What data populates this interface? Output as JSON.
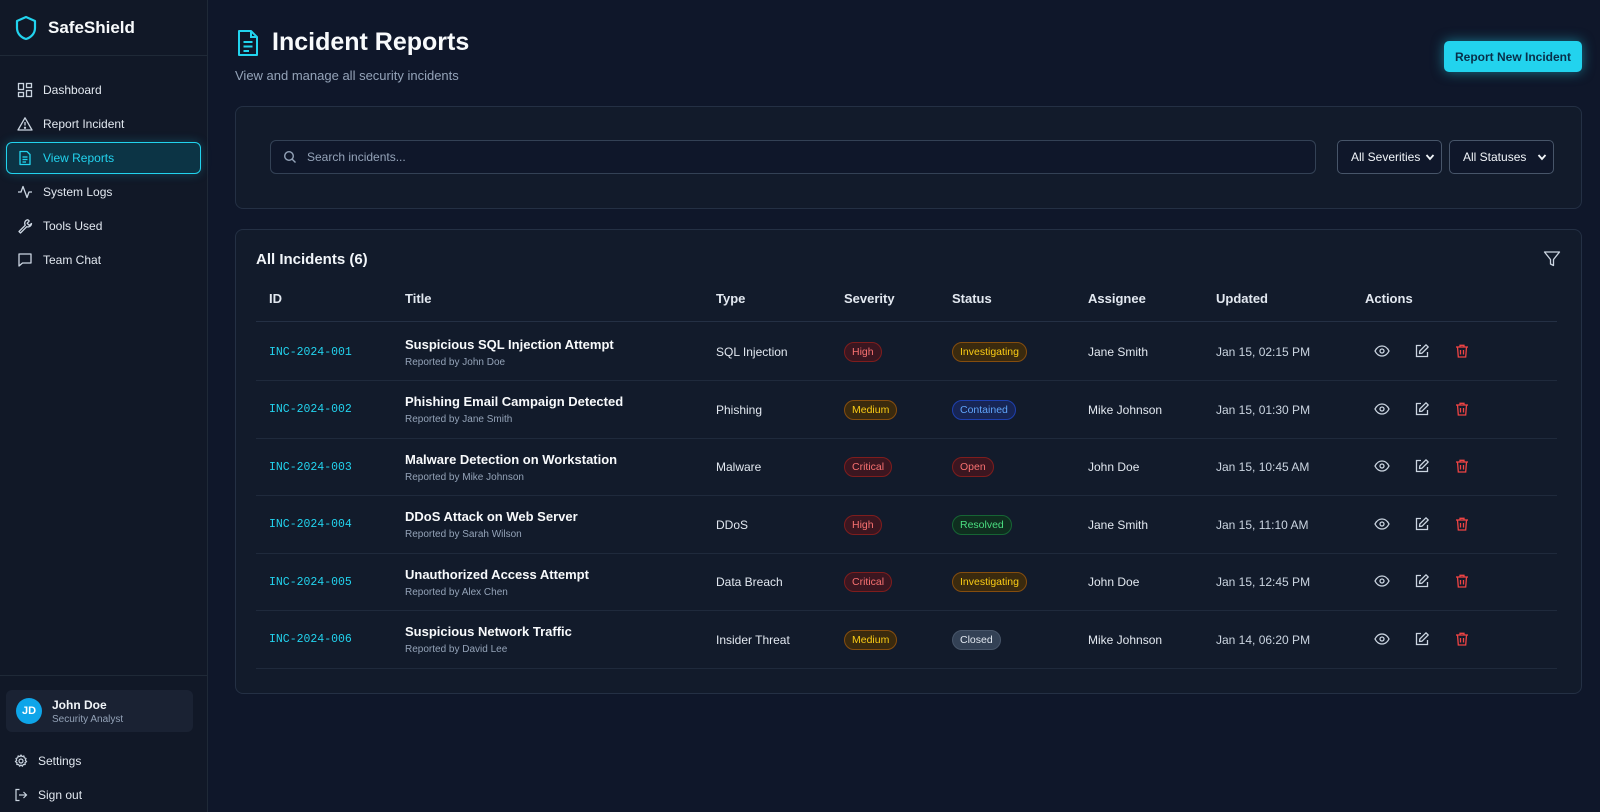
{
  "app": {
    "name": "SafeShield"
  },
  "nav": [
    {
      "label": "Dashboard",
      "icon": "dashboard-icon",
      "active": false
    },
    {
      "label": "Report Incident",
      "icon": "alert-triangle-icon",
      "active": false
    },
    {
      "label": "View Reports",
      "icon": "document-icon",
      "active": true
    },
    {
      "label": "System Logs",
      "icon": "activity-icon",
      "active": false
    },
    {
      "label": "Tools Used",
      "icon": "wrench-icon",
      "active": false
    },
    {
      "label": "Team Chat",
      "icon": "chat-icon",
      "active": false
    }
  ],
  "user": {
    "initials": "JD",
    "name": "John Doe",
    "role": "Security Analyst"
  },
  "bottom": {
    "settings": "Settings",
    "signout": "Sign out"
  },
  "page": {
    "title": "Incident Reports",
    "subtitle": "View and manage all security incidents",
    "report_button": "Report New Incident"
  },
  "filters": {
    "search_placeholder": "Search incidents...",
    "severity": "All Severities",
    "status": "All Statuses"
  },
  "table": {
    "title": "All Incidents (6)",
    "columns": [
      "ID",
      "Title",
      "Type",
      "Severity",
      "Status",
      "Assignee",
      "Updated",
      "Actions"
    ],
    "rows": [
      {
        "id": "INC-2024-001",
        "title": "Suspicious SQL Injection Attempt",
        "reporter": "Reported by John Doe",
        "type": "SQL Injection",
        "severity": "High",
        "status": "Investigating",
        "assignee": "Jane Smith",
        "updated": "Jan 15, 02:15 PM"
      },
      {
        "id": "INC-2024-002",
        "title": "Phishing Email Campaign Detected",
        "reporter": "Reported by Jane Smith",
        "type": "Phishing",
        "severity": "Medium",
        "status": "Contained",
        "assignee": "Mike Johnson",
        "updated": "Jan 15, 01:30 PM"
      },
      {
        "id": "INC-2024-003",
        "title": "Malware Detection on Workstation",
        "reporter": "Reported by Mike Johnson",
        "type": "Malware",
        "severity": "Critical",
        "status": "Open",
        "assignee": "John Doe",
        "updated": "Jan 15, 10:45 AM"
      },
      {
        "id": "INC-2024-004",
        "title": "DDoS Attack on Web Server",
        "reporter": "Reported by Sarah Wilson",
        "type": "DDoS",
        "severity": "High",
        "status": "Resolved",
        "assignee": "Jane Smith",
        "updated": "Jan 15, 11:10 AM"
      },
      {
        "id": "INC-2024-005",
        "title": "Unauthorized Access Attempt",
        "reporter": "Reported by Alex Chen",
        "type": "Data Breach",
        "severity": "Critical",
        "status": "Investigating",
        "assignee": "John Doe",
        "updated": "Jan 15, 12:45 PM"
      },
      {
        "id": "INC-2024-006",
        "title": "Suspicious Network Traffic",
        "reporter": "Reported by David Lee",
        "type": "Insider Threat",
        "severity": "Medium",
        "status": "Closed",
        "assignee": "Mike Johnson",
        "updated": "Jan 14, 06:20 PM"
      }
    ]
  },
  "colors": {
    "accent": "#22d3ee",
    "background": "#0f172a",
    "danger": "#ef4444"
  }
}
